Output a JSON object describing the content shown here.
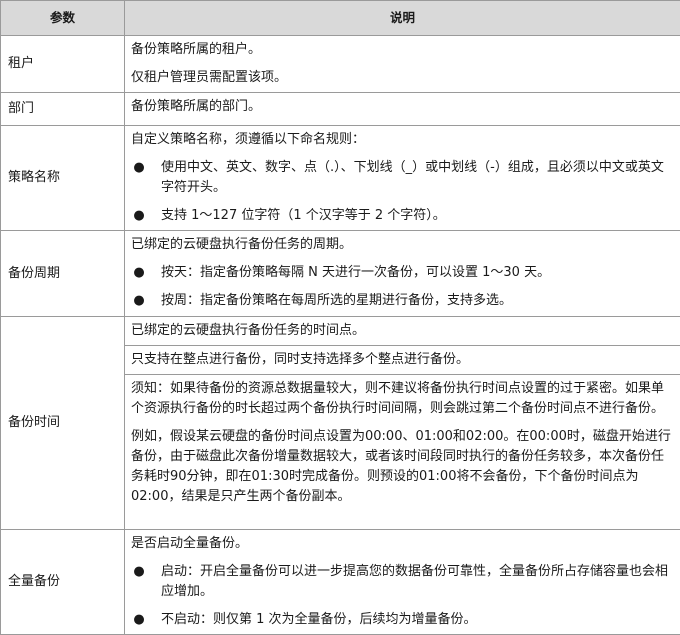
{
  "header": {
    "col_param": "参数",
    "col_desc": "说明"
  },
  "rows": [
    {
      "param": "租户",
      "lines": [
        "备份策略所属的租户。",
        "仅租户管理员需配置该项。"
      ]
    },
    {
      "param": "部门",
      "lines": [
        "备份策略所属的部门。"
      ]
    },
    {
      "param": "策略名称",
      "intro": "自定义策略名称，须遵循以下命名规则：",
      "bullets": [
        "使用中文、英文、数字、点（.）、下划线（_）或中划线（-）组成，且必须以中文或英文字符开头。",
        "支持 1～127 位字符（1 个汉字等于 2 个字符）。"
      ]
    },
    {
      "param": "备份周期",
      "intro": "已绑定的云硬盘执行备份任务的周期。",
      "bullets": [
        "按天：指定备份策略每隔 N 天进行一次备份，可以设置 1～30 天。",
        "按周：指定备份策略在每周所选的星期进行备份，支持多选。"
      ]
    },
    {
      "param": "备份时间",
      "blocks": [
        "已绑定的云硬盘执行备份任务的时间点。",
        "只支持在整点进行备份，同时支持选择多个整点进行备份。",
        "须知：如果待备份的资源总数据量较大，则不建议将备份执行时间点设置的过于紧密。如果单个资源执行备份的时长超过两个备份执行时间间隔，则会跳过第二个备份时间点不进行备份。",
        "例如，假设某云硬盘的备份时间点设置为00:00、01:00和02:00。在00:00时，磁盘开始进行备份，由于磁盘此次备份增量数据较大，或者该时间段同时执行的备份任务较多，本次备份任务耗时90分钟，即在01:30时完成备份。则预设的01:00将不会备份，下个备份时间点为02:00，结果是只产生两个备份副本。"
      ]
    },
    {
      "param": "全量备份",
      "intro": "是否启动全量备份。",
      "bullets": [
        "启动：开启全量备份可以进一步提高您的数据备份可靠性，全量备份所占存储容量也会相应增加。",
        "不启动：则仅第 1 次为全量备份，后续均为增量备份。"
      ]
    }
  ],
  "bullet_symbol": "●"
}
